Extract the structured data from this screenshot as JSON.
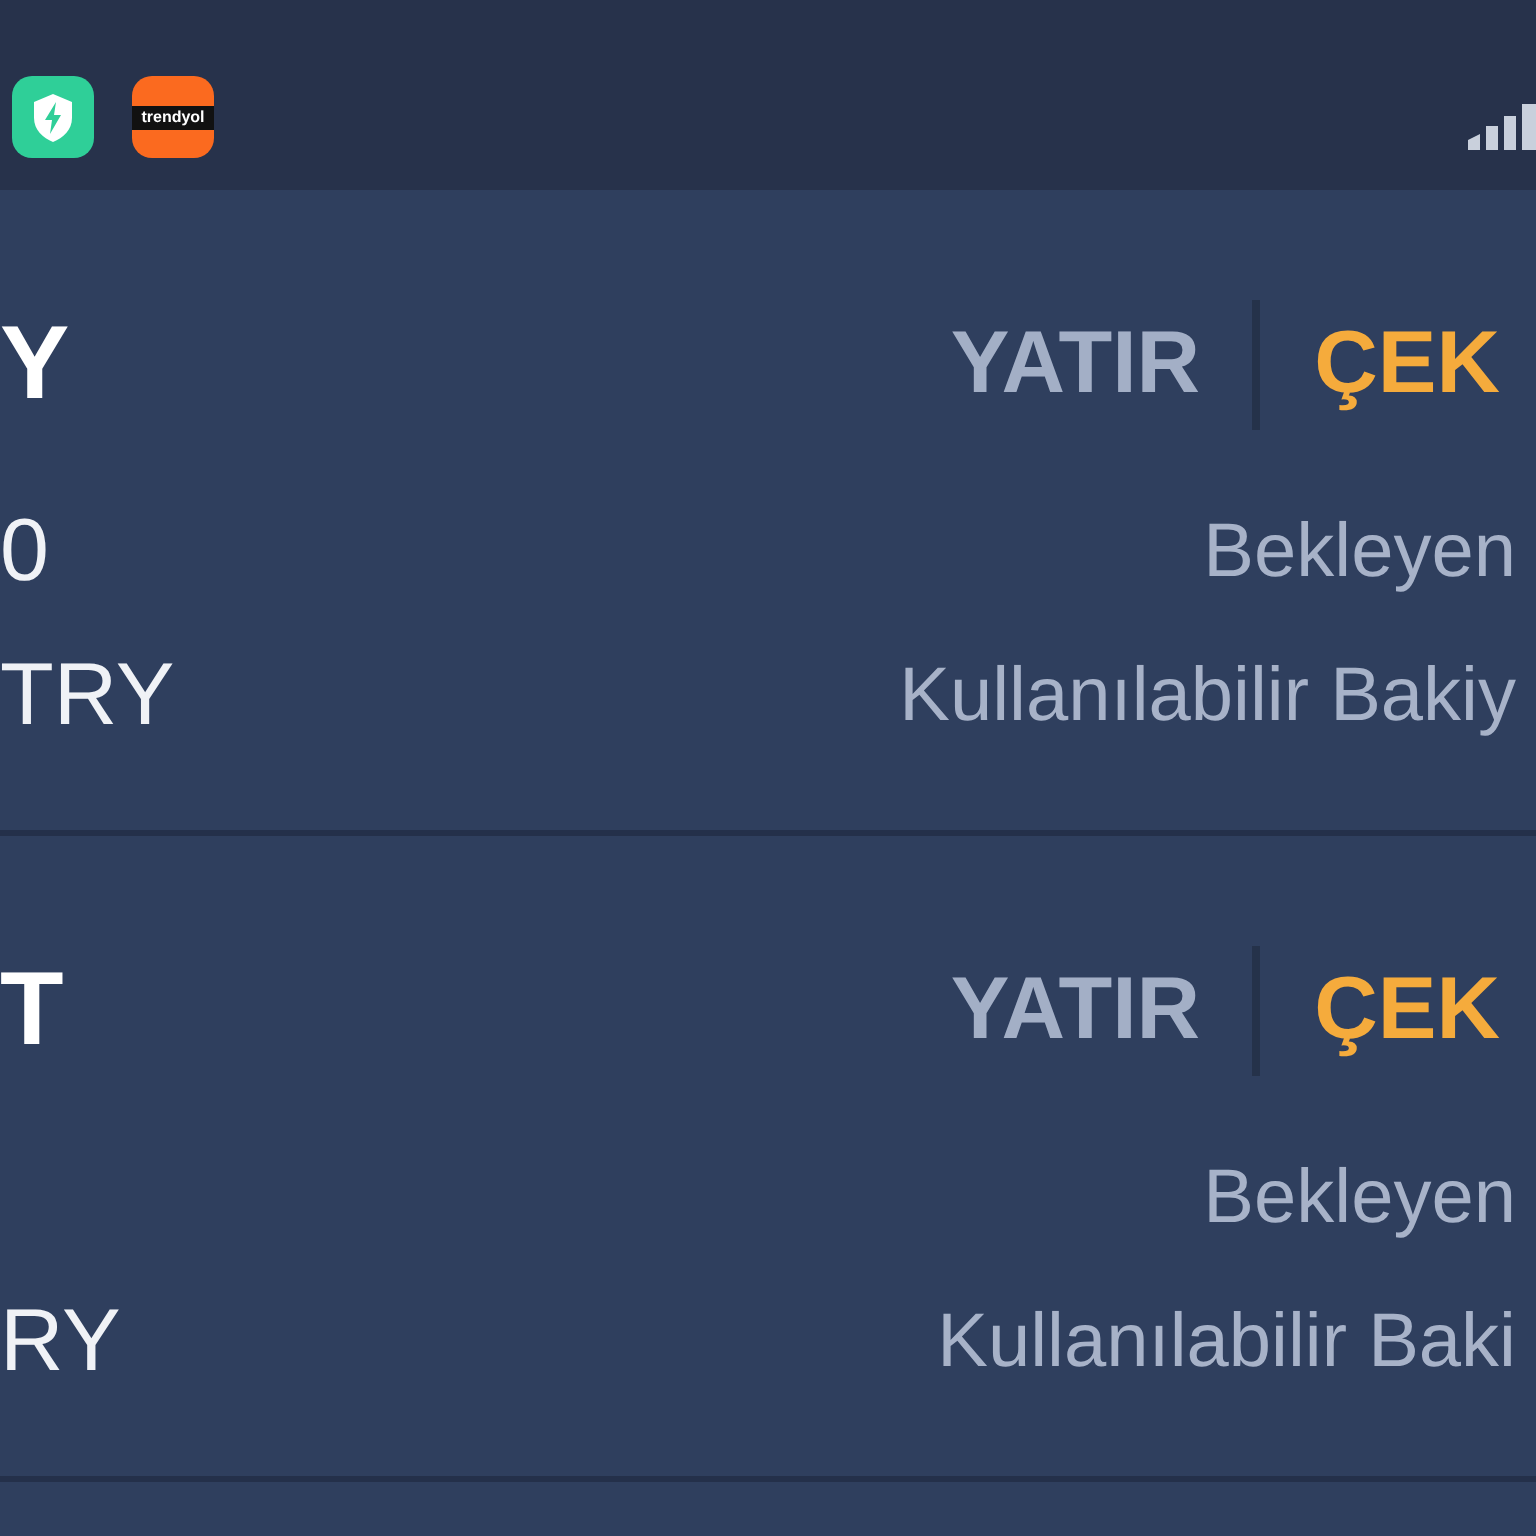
{
  "status_bar": {
    "app_label": "trendyol"
  },
  "accounts": [
    {
      "title": "Y",
      "actions": [
        {
          "label": "YATIR",
          "color": "#a3afc6"
        },
        {
          "label": "ÇEK",
          "color": "#f5ab3c"
        }
      ],
      "rows": [
        {
          "value": "0",
          "label": "Bekleyen"
        },
        {
          "value": "TRY",
          "label": "Kullanılabilir Bakiy"
        }
      ]
    },
    {
      "title": "T",
      "actions": [
        {
          "label": "YATIR",
          "color": "#a3afc6"
        },
        {
          "label": "ÇEK",
          "color": "#f5ab3c"
        }
      ],
      "rows": [
        {
          "label": "Bekleyen"
        },
        {
          "value": "RY",
          "label": "Kullanılabilir Baki"
        }
      ]
    }
  ]
}
